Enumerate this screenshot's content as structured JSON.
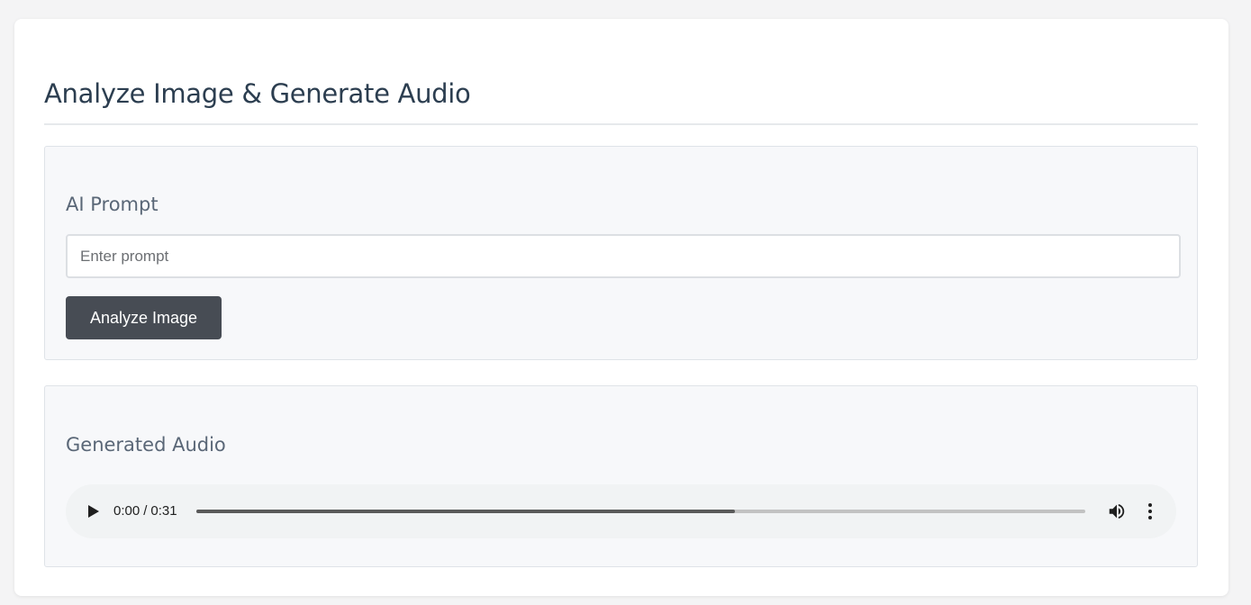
{
  "page": {
    "title": "Analyze Image & Generate Audio"
  },
  "prompt_section": {
    "heading": "AI Prompt",
    "input_value": "",
    "input_placeholder": "Enter prompt",
    "analyze_button_label": "Analyze Image"
  },
  "audio_section": {
    "heading": "Generated Audio",
    "player": {
      "current_time": "0:00",
      "separator": "/",
      "duration": "0:31",
      "buffered_fraction": 0.606,
      "icons": {
        "play": "play-icon",
        "volume": "volume-icon",
        "more": "more-options-icon"
      }
    }
  },
  "colors": {
    "title": "#2c3e50",
    "section_heading": "#5a6777",
    "button_bg": "#474c54",
    "button_text": "#ffffff",
    "panel_bg": "#f7f8fa",
    "player_bg": "#f1f3f4"
  }
}
